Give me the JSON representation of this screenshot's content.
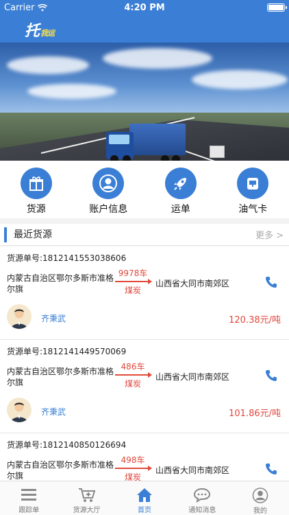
{
  "status_bar": {
    "carrier": "Carrier",
    "time": "4:20 PM"
  },
  "header": {
    "logo_text": "托",
    "logo_sub": "我运"
  },
  "menu": [
    {
      "label": "货源"
    },
    {
      "label": "账户信息"
    },
    {
      "label": "运单"
    },
    {
      "label": "油气卡"
    }
  ],
  "section": {
    "title": "最近货源",
    "more": "更多 >"
  },
  "orders": [
    {
      "order_no": "货源单号:1812141553038606",
      "from": "内蒙古自治区鄂尔多斯市准格尔旗",
      "count": "9978车",
      "goods": "煤炭",
      "to": "山西省大同市南郊区",
      "contact": "齐秉武",
      "price": "120.38元/吨"
    },
    {
      "order_no": "货源单号:1812141449570069",
      "from": "内蒙古自治区鄂尔多斯市准格尔旗",
      "count": "486车",
      "goods": "煤炭",
      "to": "山西省大同市南郊区",
      "contact": "齐秉武",
      "price": "101.86元/吨"
    },
    {
      "order_no": "货源单号:1812140850126694",
      "from": "内蒙古自治区鄂尔多斯市准格尔旗",
      "count": "498车",
      "goods": "煤炭",
      "to": "山西省大同市南郊区",
      "contact": "",
      "price": ""
    }
  ],
  "tabs": [
    {
      "label": "跟踪单",
      "icon": "list-icon"
    },
    {
      "label": "货源大厅",
      "icon": "cart-icon"
    },
    {
      "label": "首页",
      "icon": "home-icon",
      "active": true
    },
    {
      "label": "通知消息",
      "icon": "chat-icon"
    },
    {
      "label": "我的",
      "icon": "profile-icon"
    }
  ],
  "colors": {
    "primary": "#3a7fd5",
    "accent": "#e0473c"
  }
}
